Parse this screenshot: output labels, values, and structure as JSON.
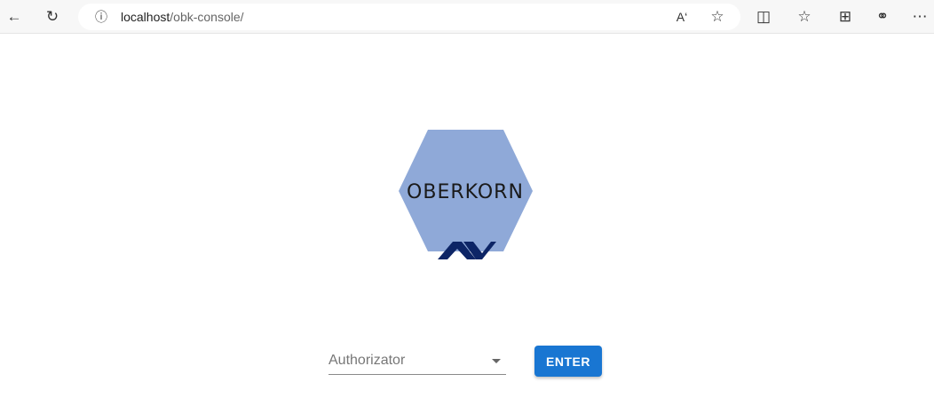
{
  "browser": {
    "url_host": "localhost",
    "url_path": "/obk-console/"
  },
  "logo": {
    "text": "OBERKORN",
    "hex_color": "#8fa9d8",
    "mark_color": "#0d2566"
  },
  "form": {
    "select_label": "Authorizator",
    "enter_label": "ENTER",
    "accent": "#1976d2"
  }
}
